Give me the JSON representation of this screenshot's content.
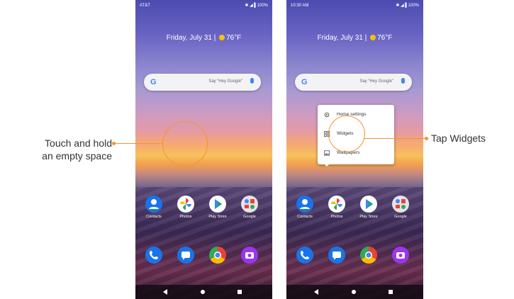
{
  "left_phone": {
    "status": {
      "carrier": "AT&T",
      "right": "✱ ◢ ▌100%"
    },
    "glance": {
      "date": "Friday, July 31",
      "separator": "|",
      "weather": "76°F"
    },
    "search": {
      "logo": "G",
      "placeholder": "Say “Hey Google”"
    },
    "apps": [
      "Contacts",
      "Photos",
      "Play Store",
      "Google"
    ]
  },
  "right_phone": {
    "status": {
      "time": "10:30 AM",
      "right": "✱ ◢ ▌100%"
    },
    "glance": {
      "date": "Friday, July 31",
      "separator": "|",
      "weather": "76°F"
    },
    "search": {
      "logo": "G",
      "placeholder": "Say “Hey Google”"
    },
    "apps": [
      "Contacts",
      "Photos",
      "Play Store",
      "Google"
    ],
    "menu": {
      "items": [
        "Home settings",
        "Widgets",
        "Wallpapers"
      ]
    }
  },
  "callouts": {
    "left_line1": "Touch and hold",
    "left_line2": "an empty space",
    "right": "Tap Widgets"
  },
  "colors": {
    "accent": "#f1962e",
    "contacts": "#1a73e8",
    "phone": "#1a73e8",
    "messages": "#1a73e8",
    "camera": "#9b34ef"
  },
  "icons": {
    "dock": [
      "phone-icon",
      "messages-icon",
      "chrome-icon",
      "camera-icon"
    ],
    "menu": [
      "gear-icon",
      "widgets-icon",
      "wallpaper-icon"
    ]
  }
}
